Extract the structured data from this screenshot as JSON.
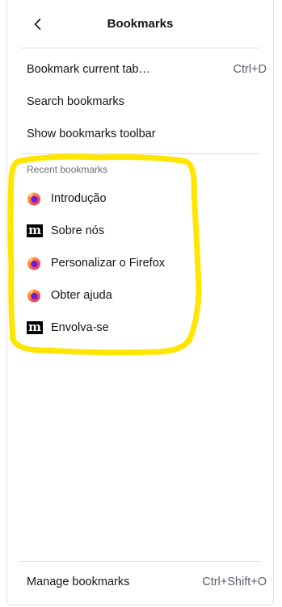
{
  "header": {
    "title": "Bookmarks"
  },
  "menu": {
    "bookmark_current_tab": {
      "label": "Bookmark current tab…",
      "shortcut": "Ctrl+D"
    },
    "search_bookmarks": {
      "label": "Search bookmarks"
    },
    "show_toolbar": {
      "label": "Show bookmarks toolbar"
    }
  },
  "recent": {
    "label": "Recent bookmarks",
    "items": [
      {
        "label": "Introdução",
        "icon": "firefox-icon"
      },
      {
        "label": "Sobre nós",
        "icon": "mozilla-m-icon"
      },
      {
        "label": "Personalizar o Firefox",
        "icon": "firefox-icon"
      },
      {
        "label": "Obter ajuda",
        "icon": "firefox-icon"
      },
      {
        "label": "Envolva-se",
        "icon": "mozilla-m-icon"
      }
    ]
  },
  "footer": {
    "manage": {
      "label": "Manage bookmarks",
      "shortcut": "Ctrl+Shift+O"
    }
  },
  "colors": {
    "highlight": "#ffe600",
    "text": "#15141a",
    "muted": "#5b5b66",
    "separator": "#e0e0e6"
  }
}
